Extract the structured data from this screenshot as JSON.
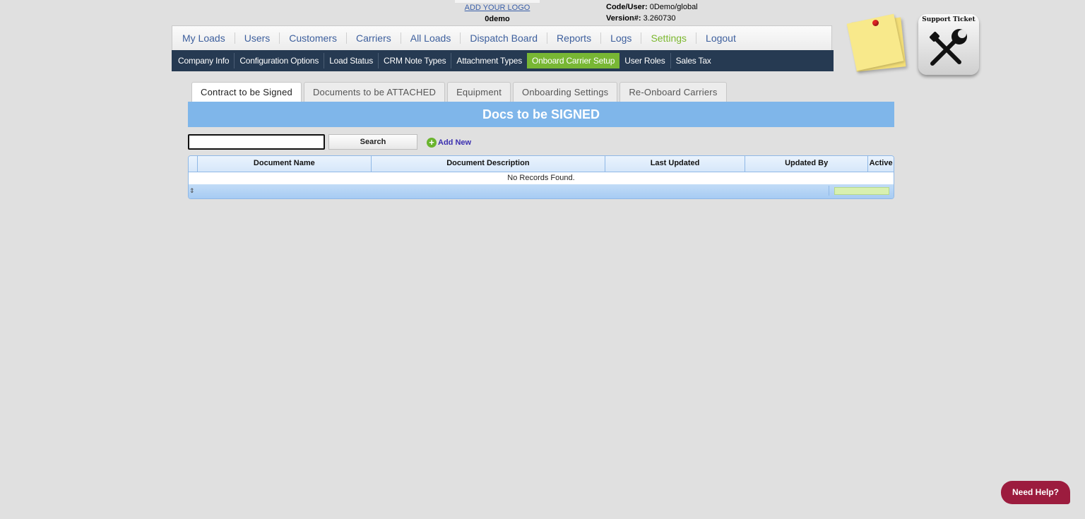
{
  "header": {
    "logo_link": "ADD YOUR LOGO",
    "company_code": "0demo",
    "code_user_label": "Code/User:",
    "code_user_value": "0Demo/global",
    "version_label": "Version#:",
    "version_value": "3.260730"
  },
  "main_nav": {
    "items": [
      {
        "label": "My Loads"
      },
      {
        "label": "Users"
      },
      {
        "label": "Customers"
      },
      {
        "label": "Carriers"
      },
      {
        "label": "All Loads"
      },
      {
        "label": "Dispatch Board"
      },
      {
        "label": "Reports"
      },
      {
        "label": "Logs"
      },
      {
        "label": "Settings",
        "active": true
      },
      {
        "label": "Logout"
      }
    ]
  },
  "sub_nav": {
    "items": [
      {
        "label": "Company Info"
      },
      {
        "label": "Configuration Options"
      },
      {
        "label": "Load Status"
      },
      {
        "label": "CRM Note Types"
      },
      {
        "label": "Attachment Types"
      },
      {
        "label": "Onboard Carrier Setup",
        "active": true
      },
      {
        "label": "User Roles"
      },
      {
        "label": "Sales Tax"
      }
    ]
  },
  "widgets": {
    "sticky_note_icon": "sticky-note-icon",
    "support_ticket_label": "Support Ticket",
    "support_ticket_icon": "wrench-icon"
  },
  "tabs": [
    {
      "label": "Contract to be Signed",
      "active": true
    },
    {
      "label": "Documents to be ATTACHED"
    },
    {
      "label": "Equipment"
    },
    {
      "label": "Onboarding Settings"
    },
    {
      "label": "Re-Onboard Carriers"
    }
  ],
  "panel": {
    "title": "Docs to be SIGNED",
    "search_value": "",
    "search_button": "Search",
    "add_new": "Add New"
  },
  "grid": {
    "columns": [
      "Document Name",
      "Document Description",
      "Last Updated",
      "Updated By",
      "Active"
    ],
    "empty_message": "No Records Found."
  },
  "help": {
    "label": "Need Help?"
  },
  "colors": {
    "nav_text": "#3d5f9d",
    "active_green": "#78b734",
    "subnav_bg": "#263a52",
    "panel_blue": "#7fb6ea",
    "help_bg": "#9c1c3e"
  }
}
